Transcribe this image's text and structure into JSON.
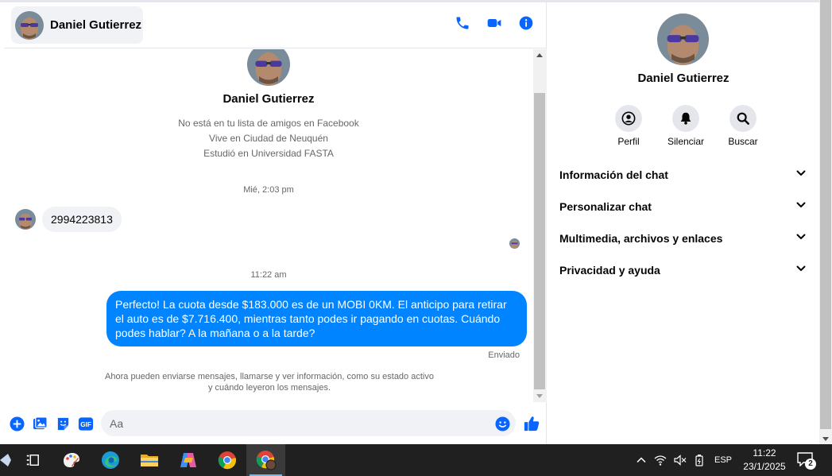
{
  "colors": {
    "accent": "#0084ff",
    "icon_blue": "#0866ff",
    "bubble_in": "#f0f2f5",
    "muted": "#65676b"
  },
  "header": {
    "contact_name": "Daniel Gutierrez",
    "icons": [
      "phone-icon",
      "video-camera-icon",
      "info-icon"
    ]
  },
  "profile": {
    "name": "Daniel Gutierrez",
    "lines": [
      "No está en tu lista de amigos en Facebook",
      "Vive en Ciudad de Neuquén",
      "Estudió en Universidad FASTA"
    ]
  },
  "messages": {
    "time1": "Mié, 2:03 pm",
    "incoming_text": "2994223813",
    "time2": "11:22 am",
    "outgoing_text": "Perfecto! La cuota desde $183.000 es de un MOBI 0KM. El anticipo para retirar el auto es de $7.716.400, mientras tanto podes ir pagando en cuotas. Cuándo podes hablar? A la mañana o a la tarde?",
    "status": "Enviado",
    "notice_line1": "Ahora pueden enviarse mensajes, llamarse y ver información, como su estado activo",
    "notice_line2": "y cuándo leyeron los mensajes."
  },
  "composer": {
    "placeholder": "Aa",
    "icons": [
      "plus-icon",
      "photo-icon",
      "sticker-icon",
      "gif-icon",
      "emoji-icon",
      "like-icon"
    ],
    "gif_label": "GIF"
  },
  "info_panel": {
    "name": "Daniel Gutierrez",
    "actions": [
      {
        "label": "Perfil",
        "icon": "profile-icon"
      },
      {
        "label": "Silenciar",
        "icon": "bell-icon"
      },
      {
        "label": "Buscar",
        "icon": "search-icon"
      }
    ],
    "sections": [
      "Información del chat",
      "Personalizar chat",
      "Multimedia, archivos y enlaces",
      "Privacidad y ayuda"
    ]
  },
  "taskbar": {
    "apps": [
      "task-view-icon",
      "paint-icon",
      "edge-icon",
      "file-explorer-icon",
      "copilot-icon",
      "chrome-icon",
      "chrome-profile-icon"
    ],
    "language": "ESP",
    "time": "11:22",
    "date": "23/1/2025",
    "notification_count": "2"
  }
}
